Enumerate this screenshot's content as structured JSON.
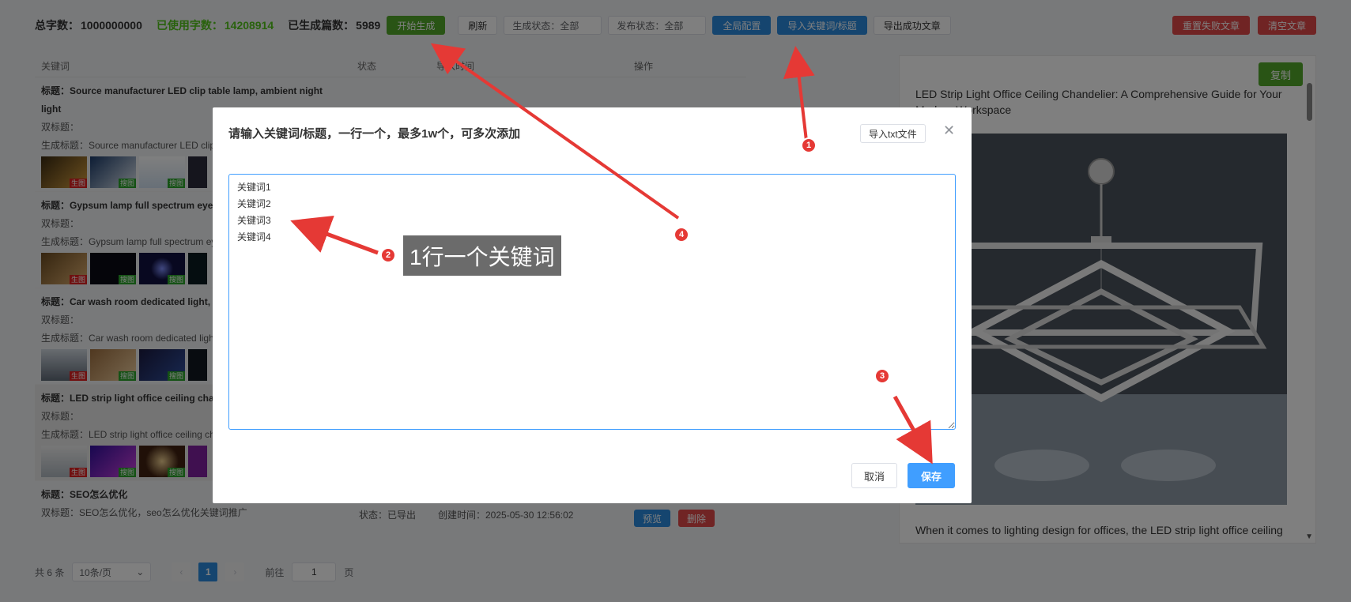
{
  "toolbar": {
    "total_label": "总字数：",
    "total_value": "1000000000",
    "used_label": "已使用字数：",
    "used_value": "14208914",
    "generated_label": "已生成篇数：",
    "generated_value": "5989",
    "start_btn": "开始生成",
    "refresh_btn": "刷新",
    "gen_status": "生成状态：全部",
    "pub_status": "发布状态：全部",
    "global_btn": "全局配置",
    "import_btn": "导入关键词/标题",
    "export_btn": "导出成功文章",
    "reset_btn": "重置失败文章",
    "clear_btn": "清空文章"
  },
  "table": {
    "columns": [
      "关键词",
      "状态",
      "导入时间",
      "操作"
    ],
    "rows": [
      {
        "title": "标题：Source manufacturer LED clip table lamp, ambient night light",
        "subtitle": "双标题：",
        "gen_title": "生成标题：Source manufacturer LED clip",
        "tags": [
          "生图",
          "搜图",
          "搜图",
          ""
        ]
      },
      {
        "title": "标题：Gypsum lamp full spectrum eye",
        "subtitle": "双标题：",
        "gen_title": "生成标题：Gypsum lamp full spectrum ey",
        "tags": [
          "生图",
          "搜图",
          "搜图",
          ""
        ]
      },
      {
        "title": "标题：Car wash room dedicated light, light",
        "subtitle": "双标题：",
        "gen_title": "生成标题：Car wash room dedicated ligh light",
        "tags": [
          "生图",
          "搜图",
          "搜图",
          ""
        ]
      },
      {
        "title": "标题：LED strip light office ceiling cha",
        "subtitle": "双标题：",
        "gen_title": "生成标题：LED strip light office ceiling ch",
        "tags": [
          "生图",
          "搜图",
          "搜图",
          ""
        ]
      },
      {
        "title": "标题：SEO怎么优化",
        "subtitle": "双标题：SEO怎么优化，seo怎么优化关键词推广",
        "status": "状态：已导出",
        "created": "创建时间：2025-05-30 12:56:02",
        "preview_btn": "预览",
        "delete_btn": "删除"
      }
    ]
  },
  "preview": {
    "copy_btn": "复制",
    "title": "LED Strip Light Office Ceiling Chandelier: A Comprehensive Guide for Your Modern Workspace",
    "text": "When it comes to lighting design for offices, the LED strip light office ceiling"
  },
  "pager": {
    "total": "共 6 条",
    "page_size": "10条/页",
    "current": "1",
    "goto_label": "前往",
    "goto_value": "1",
    "page_unit": "页"
  },
  "modal": {
    "title": "请输入关键词/标题，一行一个，最多1w个，可多次添加",
    "import_txt": "导入txt文件",
    "textarea": "关键词1\n关键词2\n关键词3\n关键词4",
    "cancel": "取消",
    "save": "保存"
  },
  "annotations": {
    "b1": "1",
    "b2": "2",
    "b3": "3",
    "b4": "4",
    "callout": "1行一个关键词",
    "arrow_color": "#e53935"
  }
}
